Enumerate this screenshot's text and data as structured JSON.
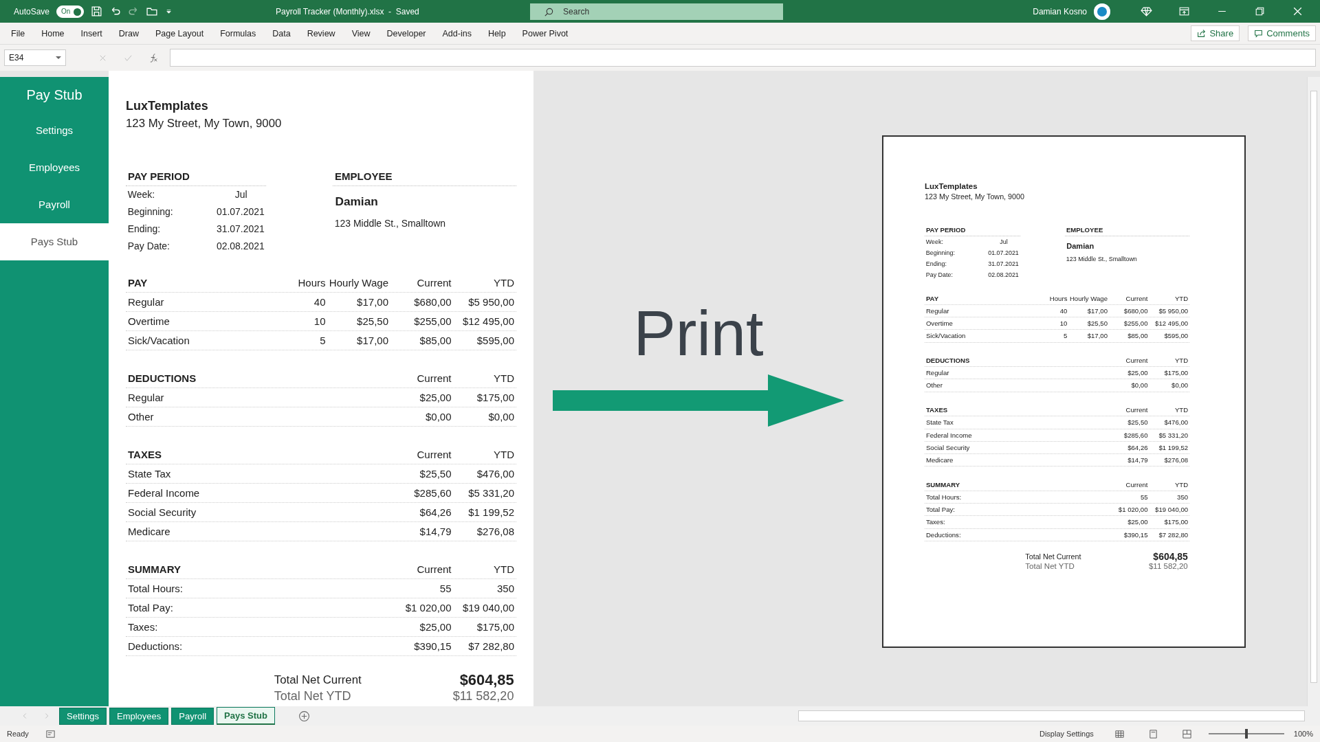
{
  "title_bar": {
    "autosave_label": "AutoSave",
    "autosave": {
      "label": "On",
      "on": true
    },
    "document_title": "Payroll Tracker (Monthly).xlsx  -  Saved",
    "search": {
      "placeholder": "Search"
    },
    "user_name": "Damian Kosno"
  },
  "ribbon": {
    "tabs": [
      "File",
      "Home",
      "Insert",
      "Draw",
      "Page Layout",
      "Formulas",
      "Data",
      "Review",
      "View",
      "Developer",
      "Add-ins",
      "Help",
      "Power Pivot"
    ],
    "share": "Share",
    "comments": "Comments"
  },
  "formula_bar": {
    "name_box": "E34"
  },
  "sidebar": {
    "title": "Pay Stub",
    "items": [
      {
        "label": "Settings",
        "selected": false
      },
      {
        "label": "Employees",
        "selected": false
      },
      {
        "label": "Payroll",
        "selected": false
      },
      {
        "label": "Pays Stub",
        "selected": true
      }
    ]
  },
  "sheet_stub": {
    "company": "LuxTemplates",
    "address": "123 My Street, My Town, 9000",
    "pay_period": {
      "title": "PAY PERIOD",
      "rows": [
        {
          "label": "Week:",
          "value": "Jul"
        },
        {
          "label": "Beginning:",
          "value": "01.07.2021"
        },
        {
          "label": "Ending:",
          "value": "31.07.2021"
        },
        {
          "label": "Pay Date:",
          "value": "02.08.2021"
        }
      ]
    },
    "employee": {
      "title": "EMPLOYEE",
      "name": "Damian",
      "address": "123 Middle St., Smalltown"
    },
    "sections": [
      {
        "title": "PAY",
        "columns": [
          "Hours",
          "Hourly Wage",
          "Current",
          "YTD"
        ],
        "rows": [
          {
            "label": "Regular",
            "values": [
              "40",
              "$17,00",
              "$680,00",
              "$5 950,00"
            ]
          },
          {
            "label": "Overtime",
            "values": [
              "10",
              "$25,50",
              "$255,00",
              "$12 495,00"
            ]
          },
          {
            "label": "Sick/Vacation",
            "values": [
              "5",
              "$17,00",
              "$85,00",
              "$595,00"
            ]
          }
        ]
      },
      {
        "title": "DEDUCTIONS",
        "columns": [
          "Current",
          "YTD"
        ],
        "rows": [
          {
            "label": "Regular",
            "values": [
              "$25,00",
              "$175,00"
            ]
          },
          {
            "label": "Other",
            "values": [
              "$0,00",
              "$0,00"
            ]
          }
        ]
      },
      {
        "title": "TAXES",
        "columns": [
          "Current",
          "YTD"
        ],
        "rows": [
          {
            "label": "State Tax",
            "values": [
              "$25,50",
              "$476,00"
            ]
          },
          {
            "label": "Federal Income",
            "values": [
              "$285,60",
              "$5 331,20"
            ]
          },
          {
            "label": "Social Security",
            "values": [
              "$64,26",
              "$1 199,52"
            ]
          },
          {
            "label": "Medicare",
            "values": [
              "$14,79",
              "$276,08"
            ]
          }
        ]
      },
      {
        "title": "SUMMARY",
        "columns": [
          "Current",
          "YTD"
        ],
        "rows": [
          {
            "label": "Total Hours:",
            "values": [
              "55",
              "350"
            ]
          },
          {
            "label": "Total Pay:",
            "values": [
              "$1 020,00",
              "$19 040,00"
            ]
          },
          {
            "label": "Taxes:",
            "values": [
              "$25,00",
              "$175,00"
            ]
          },
          {
            "label": "Deductions:",
            "values": [
              "$390,15",
              "$7 282,80"
            ]
          }
        ]
      }
    ],
    "totals": [
      {
        "kind": "current",
        "label": "Total Net Current",
        "value": "$604,85"
      },
      {
        "kind": "ytd",
        "label": "Total Net YTD",
        "value": "$11 582,20"
      }
    ]
  },
  "print_preview": {
    "label": "Print",
    "page": {
      "company": "LuxTemplates",
      "address": "123 My Street, My Town, 9000",
      "pay_period": {
        "title": "PAY PERIOD",
        "rows": [
          {
            "label": "Week:",
            "value": "Jul"
          },
          {
            "label": "Beginning:",
            "value": "01.07.2021"
          },
          {
            "label": "Ending:",
            "value": "31.07.2021"
          },
          {
            "label": "Pay Date:",
            "value": "02.08.2021"
          }
        ]
      },
      "employee": {
        "title": "EMPLOYEE",
        "name": "Damian",
        "address": "123 Middle St., Smalltown"
      },
      "sections": [
        {
          "title": "PAY",
          "columns": [
            "Hours",
            "Hourly Wage",
            "Current",
            "YTD"
          ],
          "rows": [
            {
              "label": "Regular",
              "values": [
                "40",
                "$17,00",
                "$680,00",
                "$5 950,00"
              ]
            },
            {
              "label": "Overtime",
              "values": [
                "10",
                "$25,50",
                "$255,00",
                "$12 495,00"
              ]
            },
            {
              "label": "Sick/Vacation",
              "values": [
                "5",
                "$17,00",
                "$85,00",
                "$595,00"
              ]
            }
          ]
        },
        {
          "title": "DEDUCTIONS",
          "columns": [
            "Current",
            "YTD"
          ],
          "rows": [
            {
              "label": "Regular",
              "values": [
                "$25,00",
                "$175,00"
              ]
            },
            {
              "label": "Other",
              "values": [
                "$0,00",
                "$0,00"
              ]
            }
          ]
        },
        {
          "title": "TAXES",
          "columns": [
            "Current",
            "YTD"
          ],
          "rows": [
            {
              "label": "State Tax",
              "values": [
                "$25,50",
                "$476,00"
              ]
            },
            {
              "label": "Federal Income",
              "values": [
                "$285,60",
                "$5 331,20"
              ]
            },
            {
              "label": "Social Security",
              "values": [
                "$64,26",
                "$1 199,52"
              ]
            },
            {
              "label": "Medicare",
              "values": [
                "$14,79",
                "$276,08"
              ]
            }
          ]
        },
        {
          "title": "SUMMARY",
          "columns": [
            "Current",
            "YTD"
          ],
          "rows": [
            {
              "label": "Total Hours:",
              "values": [
                "55",
                "350"
              ]
            },
            {
              "label": "Total Pay:",
              "values": [
                "$1 020,00",
                "$19 040,00"
              ]
            },
            {
              "label": "Taxes:",
              "values": [
                "$25,00",
                "$175,00"
              ]
            },
            {
              "label": "Deductions:",
              "values": [
                "$390,15",
                "$7 282,80"
              ]
            }
          ]
        }
      ],
      "totals": [
        {
          "kind": "current",
          "label": "Total Net Current",
          "value": "$604,85"
        },
        {
          "kind": "ytd",
          "label": "Total Net YTD",
          "value": "$11 582,20"
        }
      ]
    }
  },
  "sheet_tabs": [
    {
      "label": "Settings",
      "selected": false
    },
    {
      "label": "Employees",
      "selected": false
    },
    {
      "label": "Payroll",
      "selected": false
    },
    {
      "label": "Pays Stub",
      "selected": true
    }
  ],
  "status_bar": {
    "status": "Ready",
    "display_settings": "Display Settings",
    "zoom": "100%",
    "zoom_slider": {
      "level": 0.5
    }
  }
}
